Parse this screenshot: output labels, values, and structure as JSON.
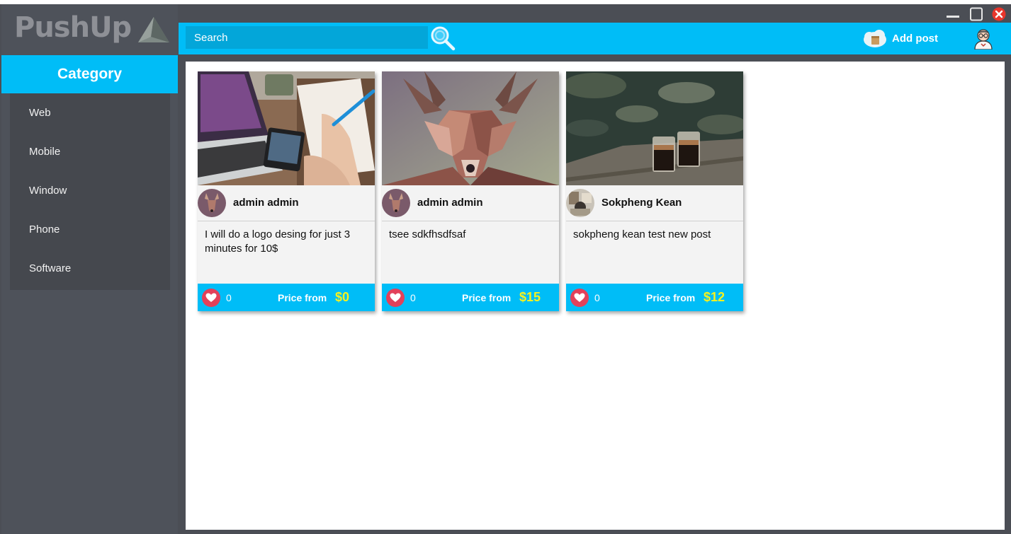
{
  "app": {
    "logo_text": "PushUp"
  },
  "sidebar": {
    "header": "Category",
    "items": [
      {
        "label": "Web"
      },
      {
        "label": "Mobile"
      },
      {
        "label": "Window"
      },
      {
        "label": "Phone"
      },
      {
        "label": "Software"
      }
    ]
  },
  "topbar": {
    "search_placeholder": "Search",
    "add_post_label": "Add post"
  },
  "posts": [
    {
      "author": "admin admin",
      "description": "I will do a logo desing for just 3 minutes for 10$",
      "likes": "0",
      "price_label": "Price from",
      "price": "$0"
    },
    {
      "author": "admin admin",
      "description": "tsee sdkfhsdfsaf",
      "likes": "0",
      "price_label": "Price from",
      "price": "$15"
    },
    {
      "author": "Sokpheng Kean",
      "description": "sokpheng kean test new post",
      "likes": "0",
      "price_label": "Price from",
      "price": "$12"
    }
  ],
  "colors": {
    "accent": "#00bdf7",
    "price": "#f6f21e",
    "like": "#e2415a",
    "sidebar": "#4e525a"
  }
}
